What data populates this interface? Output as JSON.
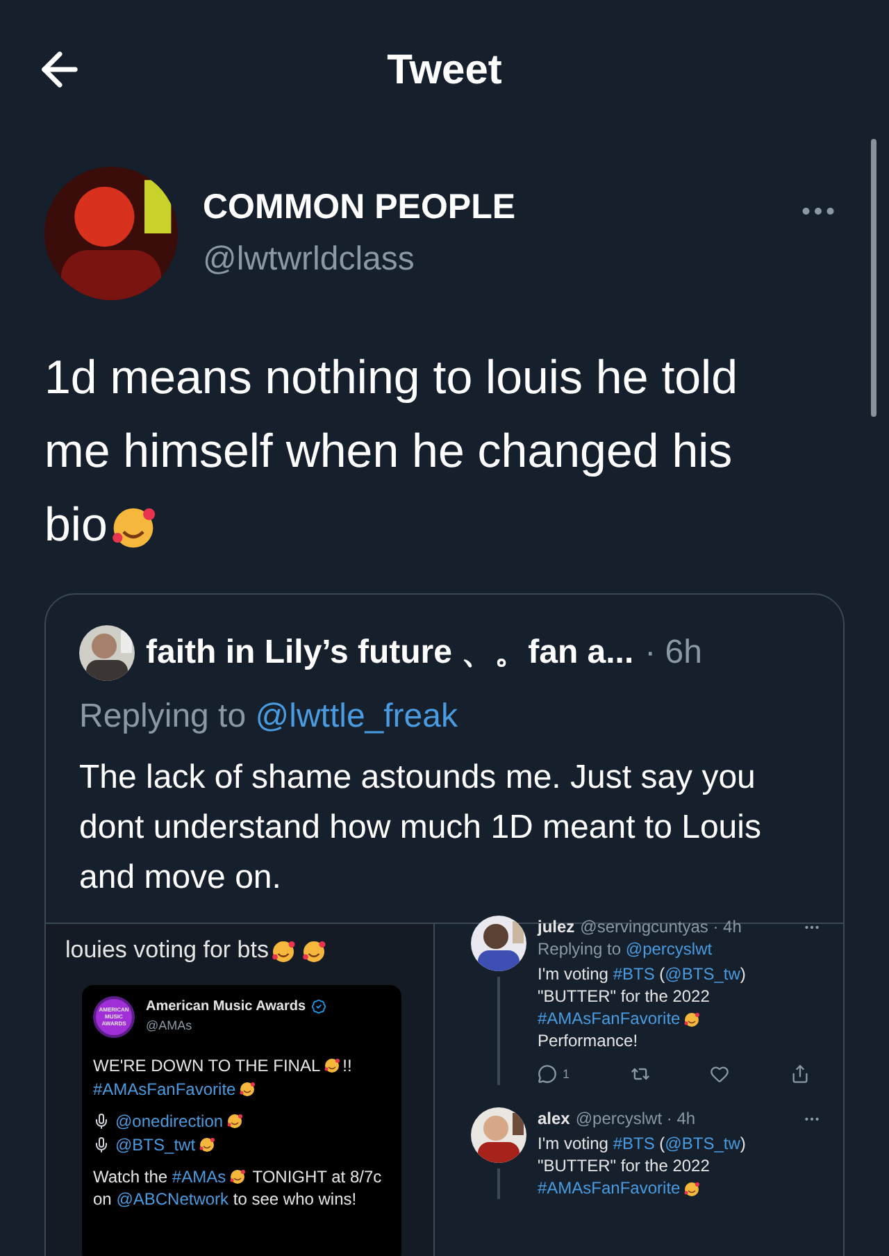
{
  "header": {
    "title": "Tweet"
  },
  "tweet": {
    "name": "COMMON PEOPLE",
    "handle": "@lwtwrldclass",
    "text": [
      {
        "kind": "text",
        "text": "1d means nothing to louis he told me himself when he changed his bio"
      },
      {
        "kind": "emoji"
      }
    ]
  },
  "quote": {
    "name": "faith in Lily’s future 、。fan a...",
    "time": "· 6h",
    "replying_prefix": "Replying to",
    "replying_handle": "@lwttle_freak",
    "text": "The lack of shame astounds me. Just say you dont understand how much 1D meant to Louis and move on."
  },
  "attachment": {
    "left": {
      "caption": [
        {
          "kind": "text",
          "text": "louies voting for bts"
        },
        {
          "kind": "emoji"
        },
        {
          "kind": "emoji"
        }
      ],
      "embedded": {
        "name": "American Music Awards",
        "verified": true,
        "handle": "@AMAs",
        "avatar_label": "AMERICAN MUSIC AWARDS",
        "lines": [
          [
            {
              "kind": "text",
              "text": "WE'RE DOWN TO THE FINAL"
            },
            {
              "kind": "emoji"
            },
            {
              "kind": "text",
              "text": "!!"
            }
          ],
          [
            {
              "kind": "link",
              "text": "#AMAsFanFavorite"
            },
            {
              "kind": "emoji"
            }
          ],
          [
            {
              "kind": "mic"
            },
            {
              "kind": "link",
              "text": "@onedirection"
            },
            {
              "kind": "emoji"
            }
          ],
          [
            {
              "kind": "mic"
            },
            {
              "kind": "link",
              "text": "@BTS_twt"
            },
            {
              "kind": "emoji"
            }
          ],
          [
            {
              "kind": "text",
              "text": "Watch the "
            },
            {
              "kind": "link",
              "text": "#AMAs"
            },
            {
              "kind": "emoji"
            },
            {
              "kind": "text",
              "text": " TONIGHT at 8/7c on "
            },
            {
              "kind": "link",
              "text": "@ABCNetwork"
            },
            {
              "kind": "text",
              "text": " to see who wins!"
            }
          ]
        ]
      }
    },
    "right": {
      "replies": [
        {
          "name": "julez",
          "handle": "@servingcuntyas · 4h",
          "replying_prefix": "Replying to",
          "replying_handle": "@percyslwt",
          "text": [
            {
              "kind": "text",
              "text": "I'm voting "
            },
            {
              "kind": "link",
              "text": "#BTS"
            },
            {
              "kind": "text",
              "text": " ("
            },
            {
              "kind": "link",
              "text": "@BTS_tw"
            },
            {
              "kind": "text",
              "text": ") \"BUTTER\" for the 2022 "
            },
            {
              "kind": "link",
              "text": "#AMAsFanFavorite"
            },
            {
              "kind": "emoji"
            },
            {
              "kind": "text",
              "text": " Performance!"
            }
          ],
          "reply_count": "1"
        },
        {
          "name": "alex",
          "handle": "@percyslwt · 4h",
          "text": [
            {
              "kind": "text",
              "text": "I'm voting "
            },
            {
              "kind": "link",
              "text": "#BTS"
            },
            {
              "kind": "text",
              "text": " ("
            },
            {
              "kind": "link",
              "text": "@BTS_tw"
            },
            {
              "kind": "text",
              "text": ") \"BUTTER\" for the 2022 "
            },
            {
              "kind": "link",
              "text": "#AMAsFanFavorite"
            },
            {
              "kind": "emoji"
            }
          ]
        }
      ]
    }
  }
}
